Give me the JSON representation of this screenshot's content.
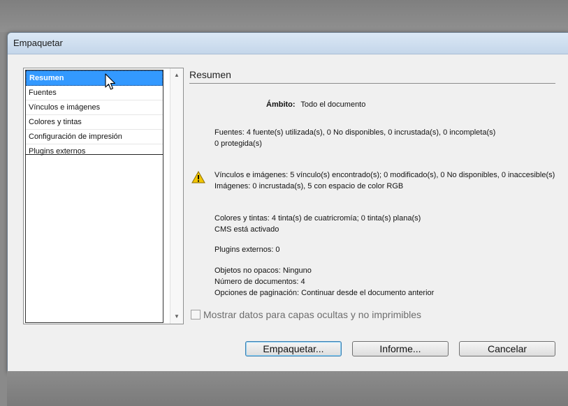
{
  "dialog": {
    "title": "Empaquetar"
  },
  "sidebar": {
    "items": [
      {
        "label": "Resumen",
        "selected": true
      },
      {
        "label": "Fuentes",
        "selected": false
      },
      {
        "label": "Vínculos e imágenes",
        "selected": false
      },
      {
        "label": "Colores y tintas",
        "selected": false
      },
      {
        "label": "Configuración de impresión",
        "selected": false
      },
      {
        "label": "Plugins externos",
        "selected": false
      }
    ]
  },
  "summary": {
    "title": "Resumen",
    "scope_label": "Ámbito:",
    "scope_value": "Todo el documento",
    "fonts_line1": "Fuentes: 4 fuente(s) utilizada(s), 0 No disponibles, 0 incrustada(s), 0 incompleta(s)",
    "fonts_line2": "0 protegida(s)",
    "links_line1": "Vínculos e imágenes: 5 vínculo(s) encontrado(s); 0 modificado(s), 0 No disponibles, 0 inaccesible(s)",
    "links_line2": "Imágenes: 0 incrustada(s), 5 con espacio de color RGB",
    "colors_line1": "Colores y tintas: 4 tinta(s) de cuatricromía; 0 tinta(s) plana(s)",
    "colors_line2": "CMS está activado",
    "plugins_line": "Plugins externos: 0",
    "opaque_line": "Objetos no opacos: Ninguno",
    "docs_line": "Número de documentos: 4",
    "pagination_line": "Opciones de paginación: Continuar desde el documento anterior"
  },
  "options": {
    "hidden_layers_label": "Mostrar datos para capas ocultas y no imprimibles",
    "hidden_layers_checked": false
  },
  "buttons": {
    "package_label": "Empaquetar...",
    "report_label": "Informe...",
    "cancel_label": "Cancelar"
  },
  "icons": {
    "warning": "warning-triangle-icon",
    "cursor": "mouse-pointer-icon",
    "scroll_up": "triangle-up-icon",
    "scroll_down": "triangle-down-icon"
  },
  "colors": {
    "selection": "#3399ff",
    "titlebar": "#c4d6ea",
    "warning": "#f2c500"
  }
}
